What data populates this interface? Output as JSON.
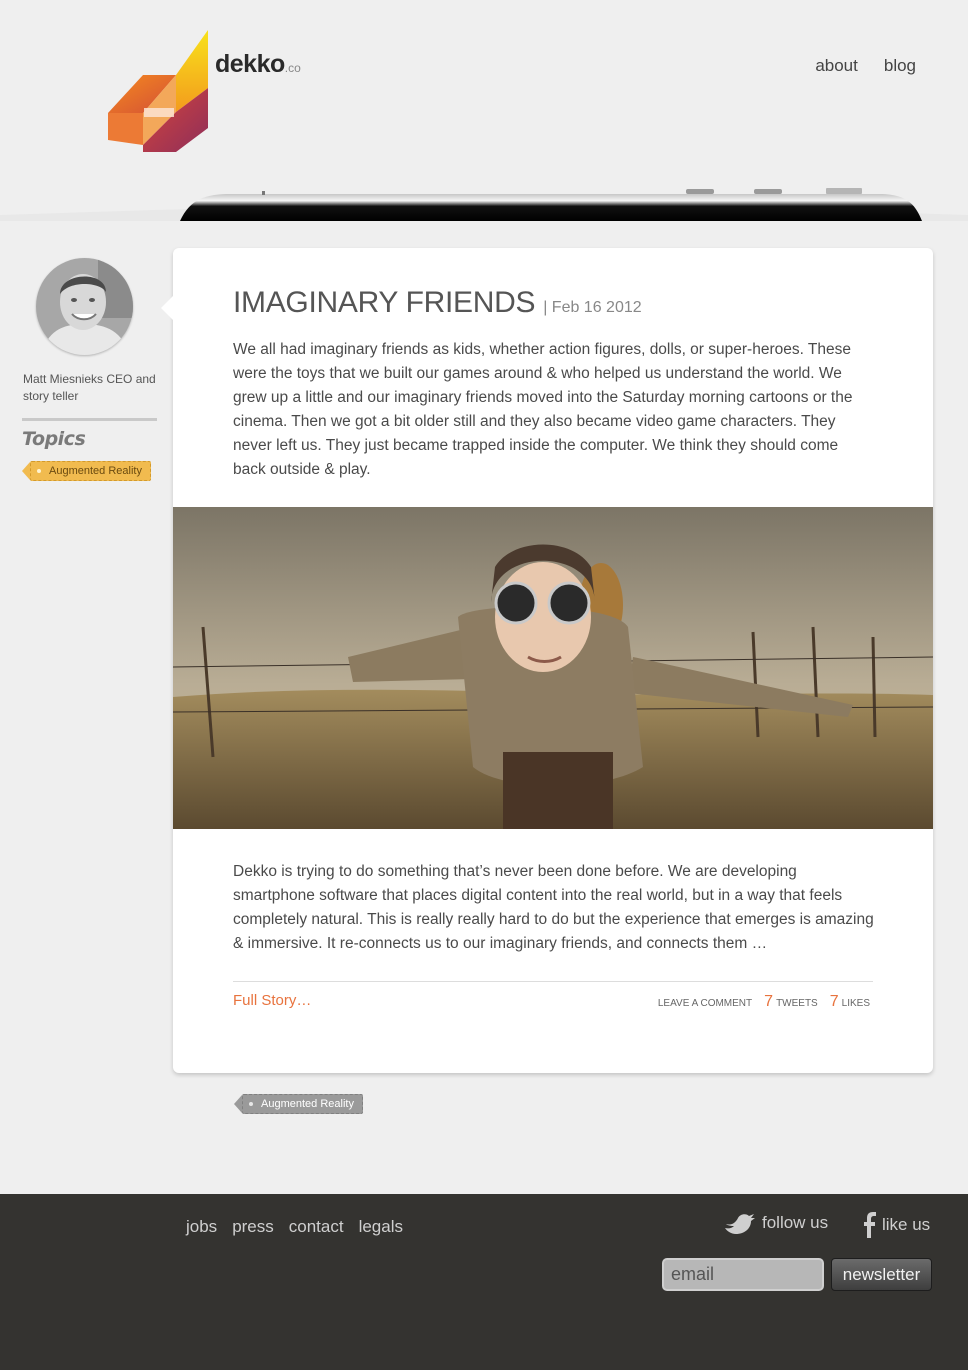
{
  "header": {
    "brand_name": "dekko",
    "brand_tld": ".co",
    "nav": [
      {
        "label": "about"
      },
      {
        "label": "blog"
      }
    ]
  },
  "sidebar": {
    "author": "Matt Miesnieks CEO and story teller",
    "topics_heading": "Topics",
    "topic_tag": "Augmented Reality"
  },
  "post": {
    "title": "IMAGINARY FRIENDS",
    "date": "| Feb 16 2012",
    "intro": "We all had imaginary friends as kids, whether action figures, dolls, or super-heroes. These were the toys that we built our games around & who helped us understand the world. We grew up a little and our imaginary friends moved into the Saturday morning cartoons or the cinema. Then we got a bit older still and they also became video game characters. They never left us. They just became trapped inside the computer. We think they should come back outside & play.",
    "body": "Dekko is trying to do something that’s never been done before. We are developing smartphone software that places digital content into the real world, but in a way that feels completely natural. This is really really hard to do but the experience that emerges is amazing & immersive. It re-connects us to our imaginary friends, and connects them …",
    "full_story": "Full Story…",
    "leave_comment": "LEAVE A COMMENT",
    "tweets_count": "7",
    "tweets_label": "TWEETS",
    "likes_count": "7",
    "likes_label": "LIKES",
    "tag": "Augmented Reality"
  },
  "footer": {
    "links": [
      "jobs",
      "press",
      "contact",
      "legals"
    ],
    "follow": "follow us",
    "like": "like us",
    "email_placeholder": "email",
    "newsletter_label": "newsletter"
  },
  "colors": {
    "accent": "#e8733e",
    "footer_bg": "#343330",
    "page_bg": "#efefef"
  }
}
